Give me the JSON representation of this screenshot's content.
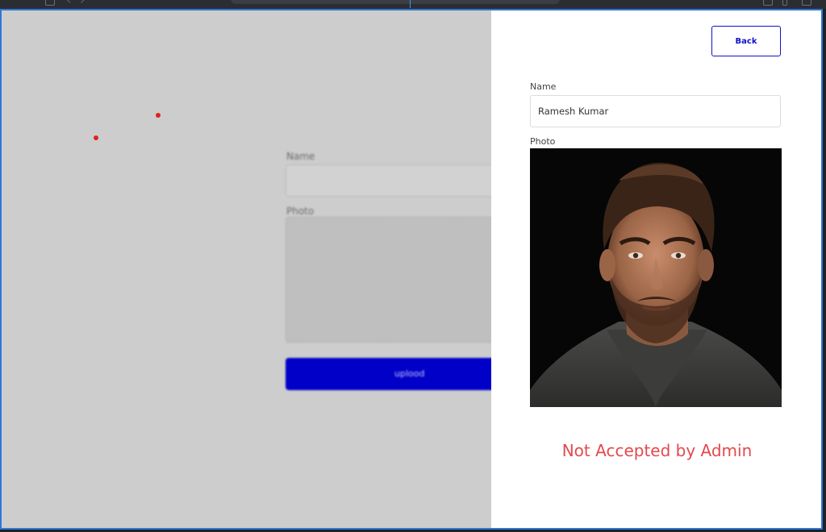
{
  "background_form": {
    "name_label": "Name",
    "photo_label": "Photo",
    "upload_label": "uplood"
  },
  "panel": {
    "back_label": "Back",
    "name_label": "Name",
    "name_value": "Ramesh Kumar",
    "photo_label": "Photo",
    "status_text": "Not Accepted by Admin"
  },
  "colors": {
    "accent": "#1111cc",
    "status": "#e5484d",
    "overlay": "#cdcdcd",
    "upload_button": "#0000c9"
  }
}
